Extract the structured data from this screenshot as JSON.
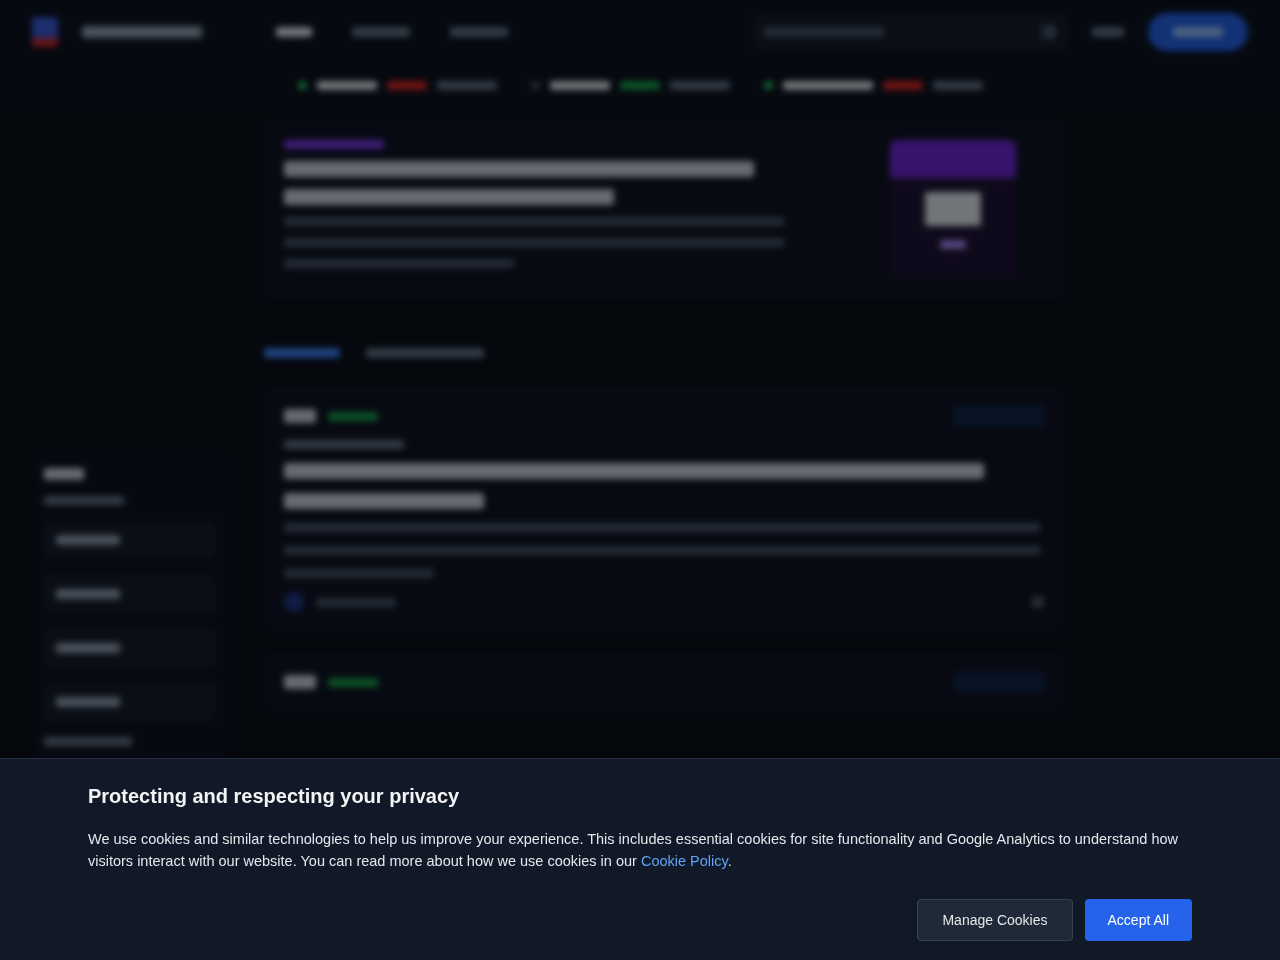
{
  "cookie": {
    "title": "Protecting and respecting your privacy",
    "text": "We use cookies and similar technologies to help us improve your experience. This includes essential cookies for site functionality and Google Analytics to understand how visitors interact with our website. You can read more about how we use cookies in our ",
    "link": "Cookie Policy",
    "after": ".",
    "manage": "Manage Cookies",
    "accept": "Accept All"
  }
}
